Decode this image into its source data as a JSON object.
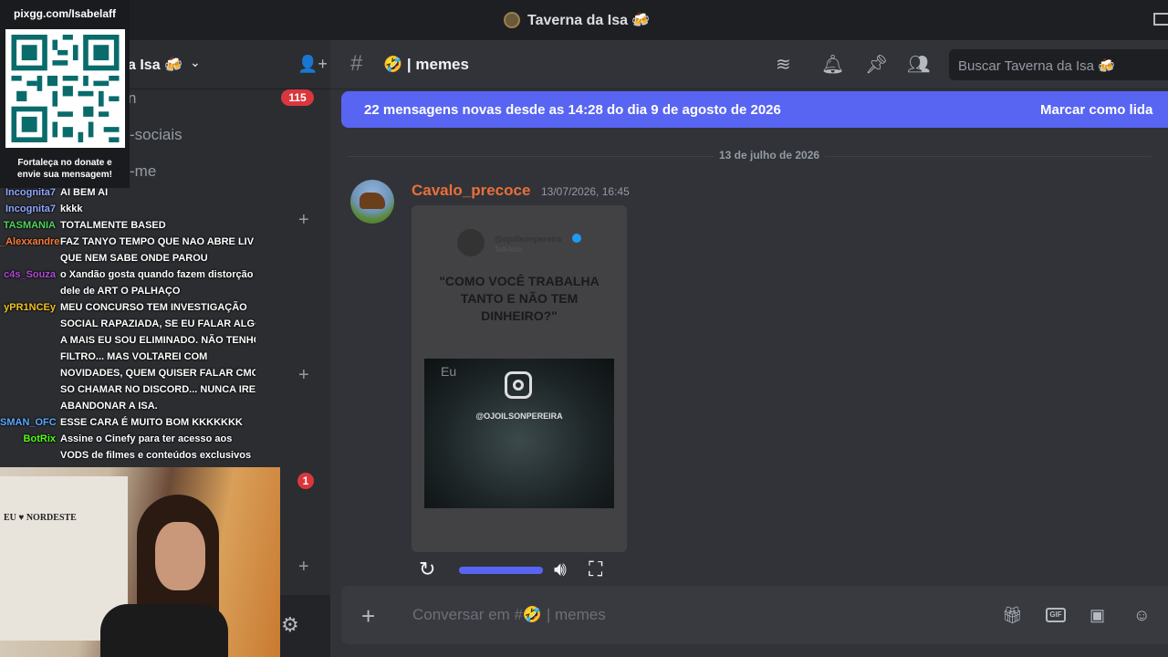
{
  "window": {
    "title": "Taverna da Isa 🍻"
  },
  "server": {
    "name_partial": "a Isa 🍻",
    "unread_badge": "115",
    "second_badge": "1"
  },
  "sidebar": {
    "partial_channels": [
      "n",
      "-sociais",
      "-me"
    ]
  },
  "overlay": {
    "qr_url": "pixgg.com/Isabelaff",
    "qr_caption_line1": "Fortaleça no donate e",
    "qr_caption_line2": "envie sua mensagem!",
    "chat": [
      {
        "user": "Incognita7",
        "color": "#8fa8ff",
        "lines": [
          "AI BEM AI"
        ]
      },
      {
        "user": "Incognita7",
        "color": "#8fa8ff",
        "lines": [
          "kkkk"
        ]
      },
      {
        "user": "TASMANIA",
        "color": "#4fd45a",
        "lines": [
          "TOTALMENTE BASED"
        ]
      },
      {
        "user": "_Alexxandre",
        "color": "#ff7b39",
        "lines": [
          "FAZ TANYO TEMPO QUE NAO ABRE LIV",
          "QUE NEM SABE ONDE PAROU"
        ]
      },
      {
        "user": "c4s_Souza",
        "color": "#b04ad8",
        "lines": [
          "o Xandão gosta quando fazem distorção",
          "dele de ART O PALHAÇO"
        ]
      },
      {
        "user": "yPR1NCEy",
        "color": "#f0c020",
        "lines": [
          "MEU CONCURSO TEM INVESTIGAÇÃO",
          "SOCIAL RAPAZIADA, SE EU FALAR ALGO",
          "A MAIS EU SOU ELIMINADO. NÃO TENHO",
          "FILTRO... MAS VOLTAREI COM",
          "NOVIDADES, QUEM QUISER FALAR CMG",
          "SO CHAMAR NO DISCORD... NUNCA IREI",
          "ABANDONAR A ISA."
        ]
      },
      {
        "user": "SMAN_OFC",
        "color": "#5aa8ff",
        "lines": [
          "ESSE CARA É MUITO BOM KKKKKKK"
        ]
      },
      {
        "user": "BotRix",
        "color": "#53fc18",
        "lines": [
          "Assine o Cinefy para ter acesso aos",
          "VODS de filmes e conteúdos exclusivos"
        ]
      }
    ],
    "webcam_banner": "EU ♥ NORDESTE"
  },
  "channel": {
    "name": "🤣 | memes",
    "search_placeholder": "Buscar Taverna da Isa 🍻"
  },
  "new_messages": {
    "text": "22 mensagens novas desde as 14:28 do dia 9 de agosto de 2026",
    "mark_read": "Marcar como lida"
  },
  "messages": {
    "date_divider": "13 de julho de 2026",
    "author": "Cavalo_precoce",
    "timestamp": "13/07/2026, 16:45",
    "tweet_handle": "@ojoilsonpereira",
    "tweet_sub": "TalkAble",
    "meme_text": "\"COMO VOCÊ TRABALHA TANTO E NÃO TEM DINHEIRO?\"",
    "meme_image_text": "Eu",
    "insta_handle": "@OJOILSONPEREIRA",
    "video_progress": 1.0
  },
  "composer": {
    "placeholder": "Conversar em #🤣 | memes"
  },
  "colors": {
    "accent": "#5865f2",
    "author": "#e8703a",
    "danger": "#da373c"
  }
}
